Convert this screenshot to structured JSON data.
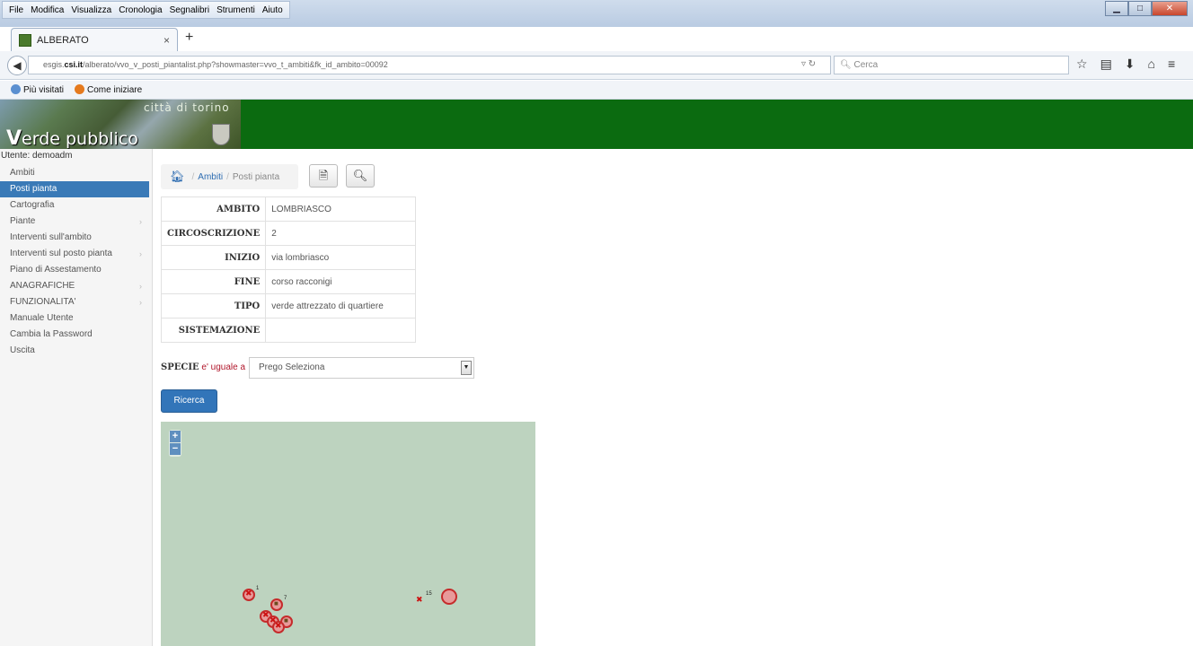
{
  "browser": {
    "menu": [
      "File",
      "Modifica",
      "Visualizza",
      "Cronologia",
      "Segnalibri",
      "Strumenti",
      "Aiuto"
    ],
    "tab_title": "ALBERATO",
    "url_host": "esgis.csi.it",
    "url_prefix": "esgis.",
    "url_domain": "csi.it",
    "url_path": "/alberato/vvo_v_posti_piantalist.php?showmaster=vvo_t_ambiti&fk_id_ambito=00092",
    "search_placeholder": "Cerca",
    "bookmarks": [
      "Più visitati",
      "Come iniziare"
    ]
  },
  "header": {
    "city": "città di torino",
    "title_initial": "V",
    "title_rest": "erde pubblico"
  },
  "sidebar": {
    "user": "Utente: demoadm",
    "items": [
      {
        "label": "Ambiti",
        "submenu": ""
      },
      {
        "label": "Posti pianta",
        "submenu": ""
      },
      {
        "label": "Cartografia",
        "submenu": ""
      },
      {
        "label": "Piante",
        "submenu": "›"
      },
      {
        "label": "Interventi sull'ambito",
        "submenu": ""
      },
      {
        "label": "Interventi sul posto pianta",
        "submenu": "›"
      },
      {
        "label": "Piano di Assestamento",
        "submenu": ""
      },
      {
        "label": "ANAGRAFICHE",
        "submenu": "›"
      },
      {
        "label": "FUNZIONALITA'",
        "submenu": "›"
      },
      {
        "label": "Manuale Utente",
        "submenu": ""
      },
      {
        "label": "Cambia la Password",
        "submenu": ""
      },
      {
        "label": "Uscita",
        "submenu": ""
      }
    ]
  },
  "breadcrumb": {
    "sep": "/",
    "parent": "Ambiti",
    "current": "Posti pianta"
  },
  "details": [
    {
      "key": "AMBITO",
      "value": "LOMBRIASCO"
    },
    {
      "key": "CIRCOSCRIZIONE",
      "value": "2"
    },
    {
      "key": "INIZIO",
      "value": "via lombriasco"
    },
    {
      "key": "FINE",
      "value": "corso racconigi"
    },
    {
      "key": "TIPO",
      "value": "verde attrezzato di quartiere"
    },
    {
      "key": "SISTEMAZIONE",
      "value": ""
    }
  ],
  "filter": {
    "field": "SPECIE",
    "operator": "e' uguale a",
    "selected": "Prego Seleziona"
  },
  "search_button": "Ricerca",
  "map": {
    "zoom_in": "+",
    "zoom_out": "−",
    "marker_labels": [
      "1",
      "7",
      "15"
    ]
  },
  "colors": {
    "header_green": "#0b6b10",
    "accent_blue": "#3275b9",
    "map_bg": "#bdd3bf",
    "marker_red": "#c52b2b"
  }
}
